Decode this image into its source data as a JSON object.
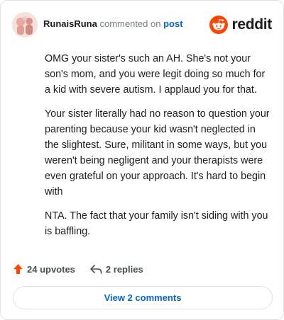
{
  "colors": {
    "accent": "#ff4500",
    "link": "#0a66c2",
    "muted": "#787c7e"
  },
  "header": {
    "username": "RunaisRuna",
    "commented_text": "commented on",
    "post_link": "post",
    "avatar_icon": "user-avatar",
    "brand_icon": "reddit-snoo-icon",
    "brand_text": "reddit"
  },
  "comment": {
    "paragraphs": [
      "OMG your sister's such an AH. She's not your son's mom, and you were legit doing so much for a kid with severe autism. I applaud you for that.",
      "Your sister literally had no reason to question your parenting because your kid wasn't neglected in the slightest. Sure, militant in some ways, but you weren't being negligent and your therapists were even grateful on your approach. It's hard to begin with",
      "NTA. The fact that your family isn't siding with you is baffling."
    ]
  },
  "actions": {
    "upvotes": "24 upvotes",
    "upvote_icon": "upvote-arrow-icon",
    "replies": "2 replies",
    "reply_icon": "reply-arrow-icon"
  },
  "footer": {
    "view_comments": "View 2 comments"
  }
}
